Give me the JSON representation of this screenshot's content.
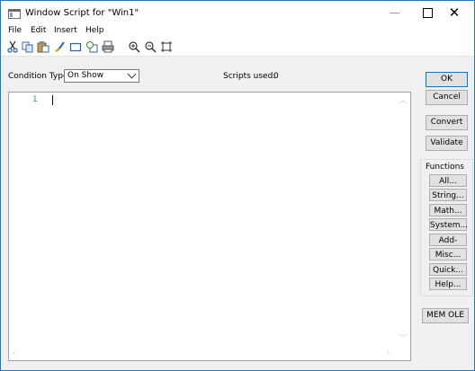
{
  "window": {
    "title": "Window Script for \"Win1\"",
    "min": "—",
    "close": "✕"
  },
  "menu": [
    "File",
    "Edit",
    "Insert",
    "Help"
  ],
  "toolbar": {
    "icons": [
      "cut-icon",
      "copy-icon",
      "paste-icon",
      "brush-icon",
      "rectangle-icon",
      "objects-icon",
      "print-icon",
      "zoom-in-icon",
      "zoom-out-icon",
      "fit-icon"
    ]
  },
  "condition": {
    "label": "Condition Type:",
    "value": "On Show"
  },
  "scripts": {
    "label": "Scripts used:",
    "value": "0"
  },
  "editor": {
    "line_number": "1"
  },
  "buttons": {
    "ok": "OK",
    "cancel": "Cancel",
    "convert": "Convert",
    "validate": "Validate",
    "mem_ole": "MEM OLE"
  },
  "functions": {
    "label": "Functions",
    "items": [
      "All...",
      "String...",
      "Math...",
      "System...",
      "Add-ons...",
      "Misc...",
      "Quick...",
      "Help..."
    ]
  },
  "colors": {
    "accent": "#0078d7",
    "line_number": "#2b91af",
    "window_border": "#1979ca"
  }
}
